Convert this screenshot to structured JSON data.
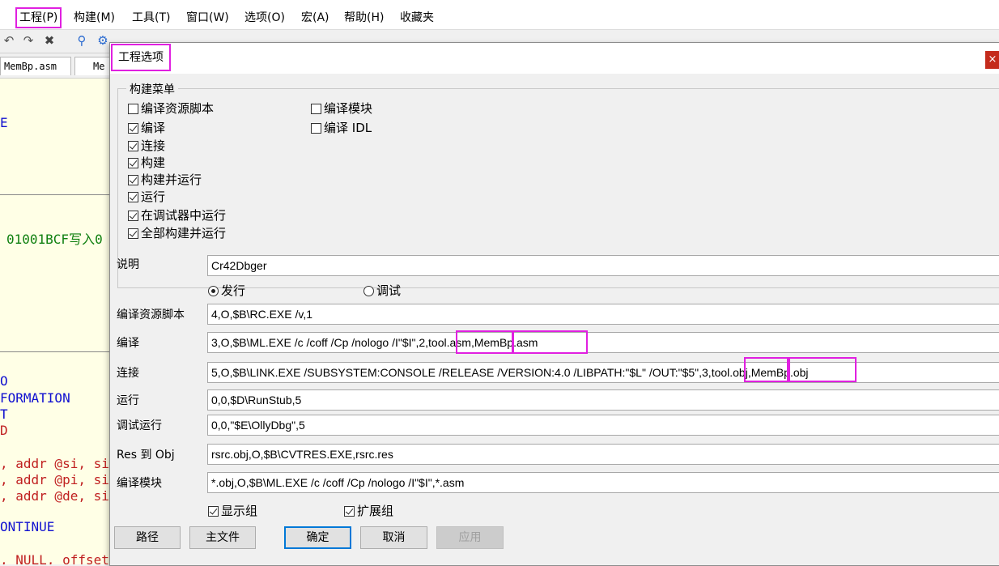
{
  "menubar": {
    "items": [
      "工程(P)",
      "构建(M)",
      "工具(T)",
      "窗口(W)",
      "选项(O)",
      "宏(A)",
      "帮助(H)",
      "收藏夹"
    ]
  },
  "filetabs": [
    "MemBp.asm",
    "Me"
  ],
  "editor": {
    "lines": [
      {
        "text": "E"
      },
      {
        "text": "01001BCF写入0"
      },
      {
        "text": "O"
      },
      {
        "text": "FORMATION"
      },
      {
        "text": "T"
      },
      {
        "text": "D"
      },
      {
        "text": ", addr @si, si"
      },
      {
        "text": ", addr @pi, si"
      },
      {
        "text": ", addr @de, si"
      },
      {
        "text": "ONTINUE"
      },
      {
        "text": ", NULL, offset"
      }
    ]
  },
  "dialog": {
    "title": "工程选项",
    "close_glyph": "×",
    "group_title": "构建菜单",
    "checks_left": [
      {
        "label": "编译资源脚本",
        "checked": false
      },
      {
        "label": "编译",
        "checked": true
      },
      {
        "label": "连接",
        "checked": true
      },
      {
        "label": "构建",
        "checked": true
      },
      {
        "label": "构建并运行",
        "checked": true
      },
      {
        "label": "运行",
        "checked": true
      },
      {
        "label": "在调试器中运行",
        "checked": true
      },
      {
        "label": "全部构建并运行",
        "checked": true
      }
    ],
    "checks_right": [
      {
        "label": "编译模块",
        "checked": false
      },
      {
        "label": "编译 IDL",
        "checked": false
      }
    ],
    "description_label": "说明",
    "description_value": "Cr42Dbger",
    "radio_release": "发行",
    "radio_debug": "调试",
    "fields": [
      {
        "label": "编译资源脚本",
        "value": "4,O,$B\\RC.EXE /v,1"
      },
      {
        "label": "编译",
        "value": "3,O,$B\\ML.EXE /c /coff /Cp /nologo /I\"$I\",2,tool.asm,MemBp.asm"
      },
      {
        "label": "连接",
        "value": "5,O,$B\\LINK.EXE /SUBSYSTEM:CONSOLE /RELEASE /VERSION:4.0 /LIBPATH:\"$L\" /OUT:\"$5\",3,tool.obj,MemBp.obj"
      },
      {
        "label": "运行",
        "value": "0,0,$D\\RunStub,5"
      },
      {
        "label": "调试运行",
        "value": "0,0,\"$E\\OllyDbg\",5"
      },
      {
        "label": "Res 到 Obj",
        "value": "rsrc.obj,O,$B\\CVTRES.EXE,rsrc.res"
      },
      {
        "label": "编译模块",
        "value": "*.obj,O,$B\\ML.EXE /c /coff /Cp /nologo /I\"$I\",*.asm"
      }
    ],
    "show_group": {
      "label": "显示组",
      "checked": true
    },
    "expand_group": {
      "label": "扩展组",
      "checked": true
    },
    "buttons": {
      "path": "路径",
      "main_file": "主文件",
      "ok": "确定",
      "cancel": "取消",
      "apply": "应用"
    }
  }
}
